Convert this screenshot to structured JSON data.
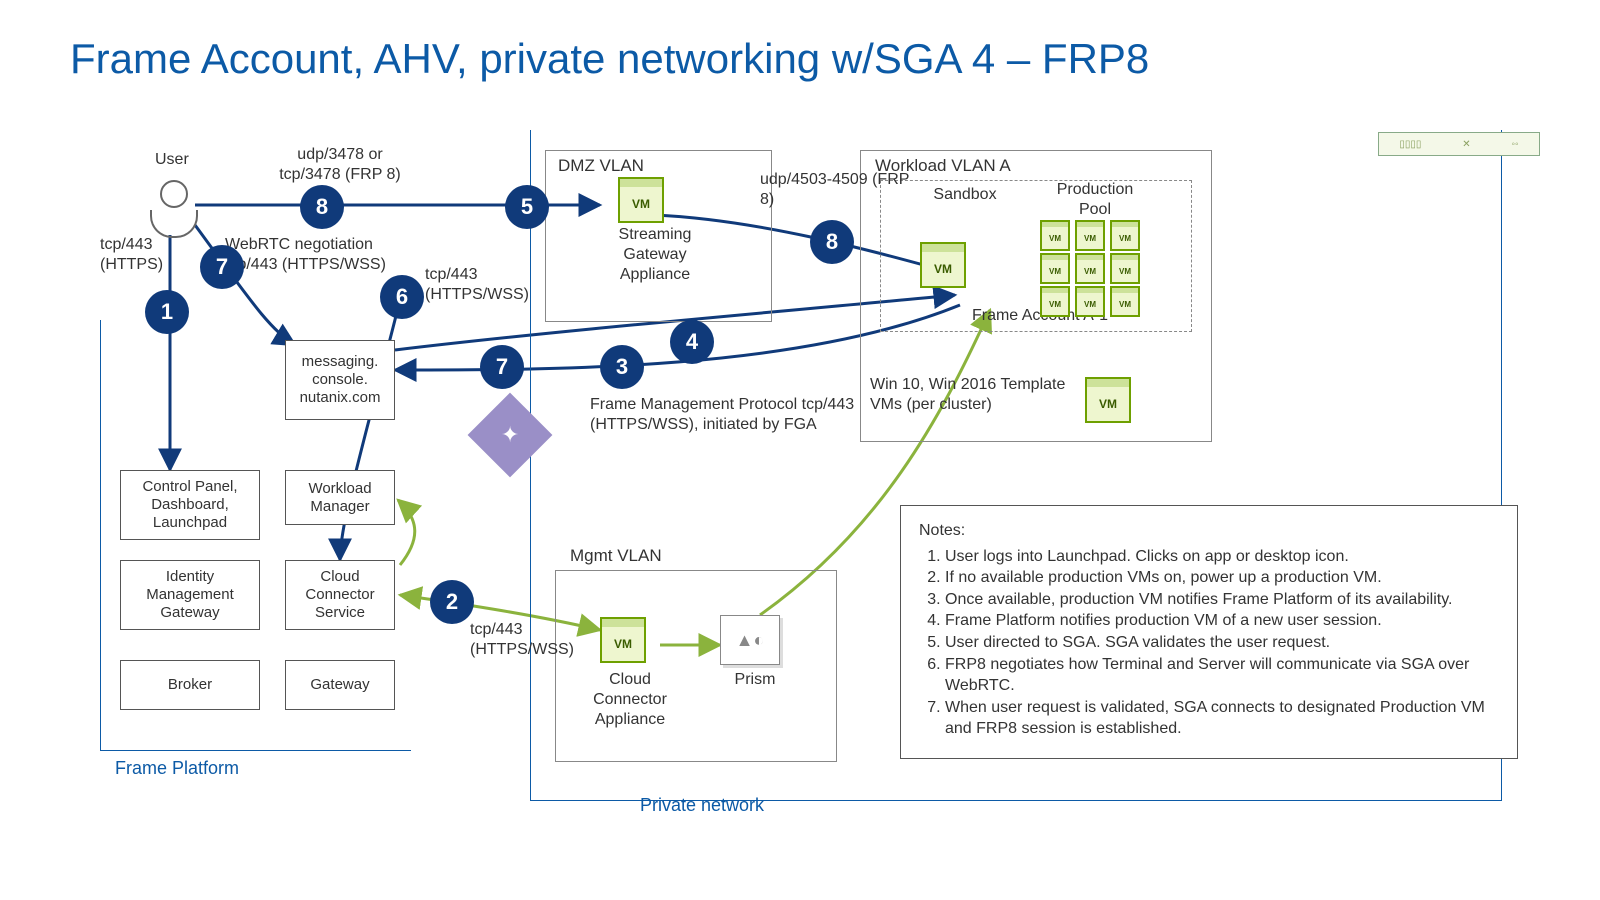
{
  "title": "Frame Account, AHV, private networking w/SGA 4 – FRP8",
  "regions": {
    "framePlatform": "Frame Platform",
    "privateNetwork": "Private network",
    "dmz": "DMZ VLAN",
    "mgmt": "Mgmt VLAN",
    "workloadA": "Workload VLAN A",
    "sandbox": "Sandbox",
    "prodPool": "Production Pool",
    "frameAccount": "Frame Account A-1"
  },
  "nodes": {
    "user": "User",
    "controlPanel": "Control Panel, Dashboard, Launchpad",
    "idm": "Identity Management Gateway",
    "broker": "Broker",
    "messaging": "messaging.\nconsole.\nnutanix.com",
    "workloadMgr": "Workload Manager",
    "ccs": "Cloud Connector Service",
    "gateway": "Gateway",
    "sga": "Streaming Gateway Appliance",
    "cca": "Cloud Connector Appliance",
    "prism": "Prism",
    "templateVMs": "Win 10, Win 2016 Template VMs (per cluster)"
  },
  "edgeLabels": {
    "userToSGA": "udp/3478 or\ntcp/3478 (FRP 8)",
    "userToCP": "tcp/443 (HTTPS)",
    "webrtc": "WebRTC negotiation\ntcp/443 (HTTPS/WSS)",
    "sixLabel": "tcp/443 (HTTPS/WSS)",
    "sgaToPool": "udp/4503-4509 (FRP 8)",
    "fmp": "Frame Management Protocol tcp/443 (HTTPS/WSS), initiated by FGA",
    "ccsProto": "tcp/443 (HTTPS/WSS)"
  },
  "notes": {
    "heading": "Notes:",
    "items": [
      "User logs into Launchpad. Clicks on app or desktop icon.",
      "If no available production VMs on, power up a production VM.",
      "Once available, production VM notifies Frame Platform of its availability.",
      "Frame Platform notifies production VM of a new user session.",
      "User directed to SGA. SGA validates the user request.",
      "FRP8 negotiates how Terminal and Server will communicate via SGA over WebRTC.",
      "When user request is validated, SGA connects to designated Production VM and FRP8 session is established."
    ]
  },
  "vmGlyph": "VM"
}
